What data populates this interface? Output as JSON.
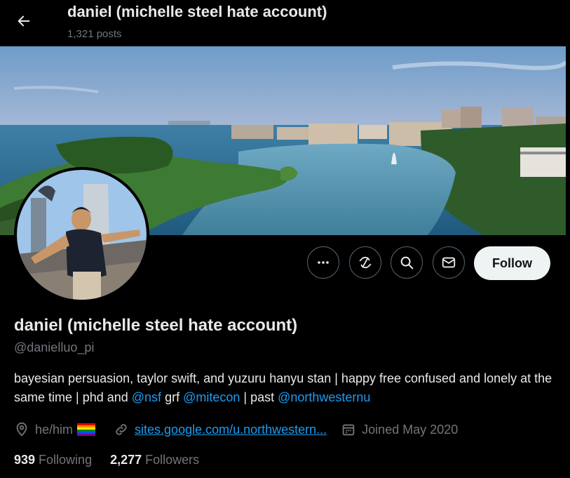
{
  "header": {
    "title": "daniel (michelle steel hate account)",
    "posts": "1,321 posts"
  },
  "profile": {
    "display_name": "daniel (michelle steel hate account)",
    "handle": "@danielluo_pi",
    "bio": {
      "text1": "bayesian persuasion, taylor swift, and yuzuru hanyu stan | happy free confused and lonely at the same time | phd and ",
      "mention1": "@nsf",
      "text2": " grf ",
      "mention2": "@mitecon",
      "text3": " | past ",
      "mention3": "@northwesternu"
    },
    "pronouns": "he/him",
    "website": "sites.google.com/u.northwestern...",
    "joined": "Joined May 2020",
    "following_count": "939",
    "following_label": "Following",
    "followers_count": "2,277",
    "followers_label": "Followers"
  },
  "actions": {
    "follow_label": "Follow",
    "more_icon": "more-icon",
    "subscribe_icon": "subscribe-icon",
    "search_icon": "search-icon",
    "message_icon": "mail-icon"
  },
  "colors": {
    "background": "#000000",
    "text_primary": "#e7e9ea",
    "text_secondary": "#71767b",
    "accent": "#1d9bf0",
    "follow_button_bg": "#eff3f4"
  }
}
